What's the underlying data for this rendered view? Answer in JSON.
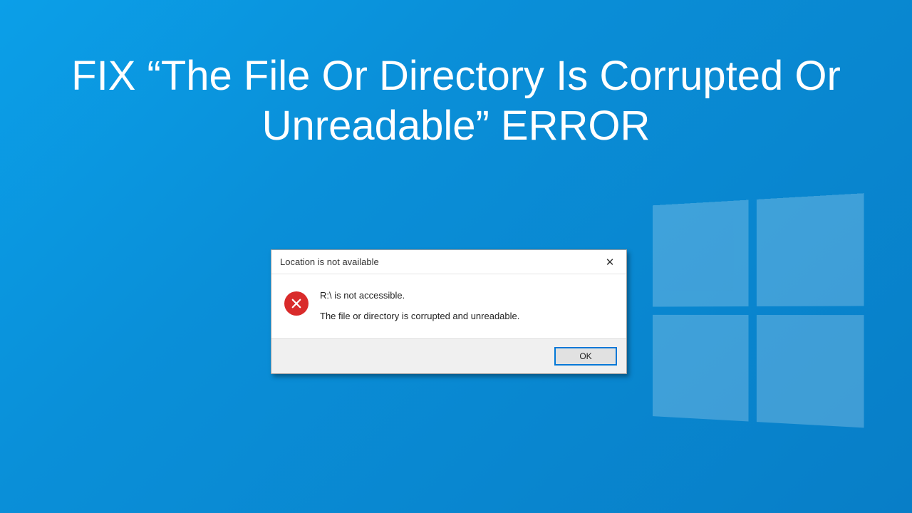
{
  "headline": "FIX “The File Or Directory Is Corrupted Or Unreadable” ERROR",
  "dialog": {
    "title": "Location is not available",
    "message_heading": "R:\\ is not accessible.",
    "message_detail": "The file or directory is corrupted and unreadable.",
    "ok_label": "OK"
  }
}
